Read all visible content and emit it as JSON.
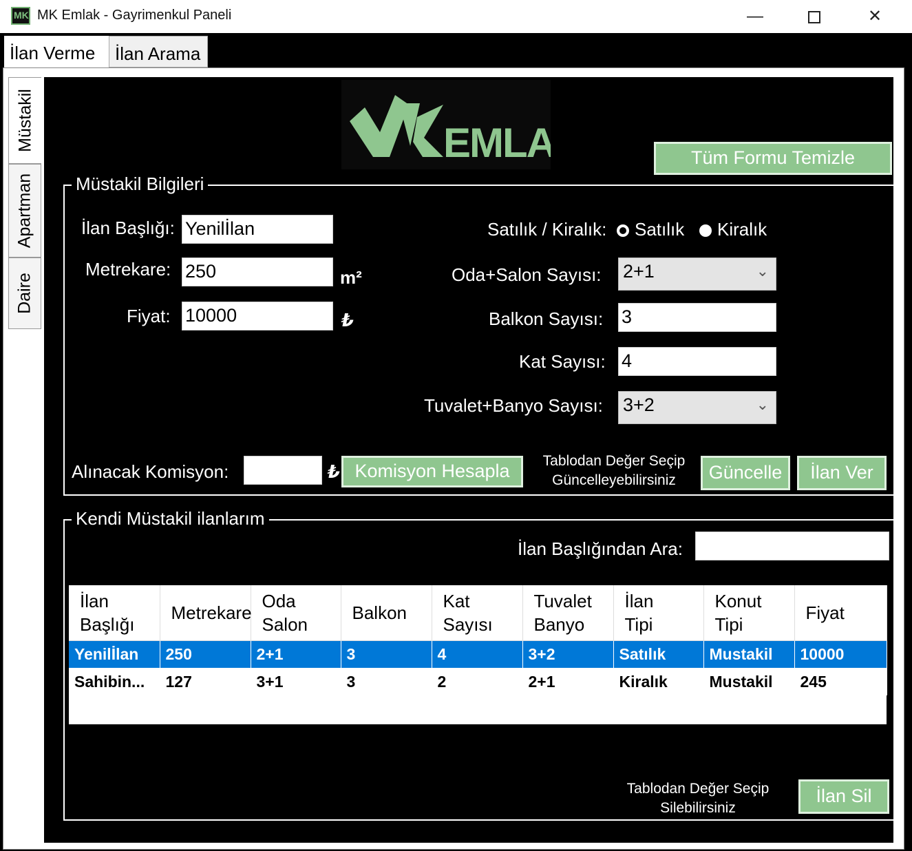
{
  "window": {
    "title": "MK Emlak - Gayrimenkul Paneli",
    "icon_text": "MK",
    "controls": {
      "minimize": "—",
      "close": "✕"
    }
  },
  "tabs": {
    "top": [
      {
        "label": "İlan Verme"
      },
      {
        "label": "İlan Arama"
      }
    ],
    "side": [
      {
        "label": "Müstakil"
      },
      {
        "label": "Apartman"
      },
      {
        "label": "Daire"
      }
    ]
  },
  "logo": {
    "text": "EMLAK",
    "color": "#8fc68f"
  },
  "clear_form_button": "Tüm Formu Temizle",
  "info_group": {
    "title": "Müstakil Bilgileri",
    "ilan_basligi": {
      "label": "İlan Başlığı:",
      "value": "Yenilİlan"
    },
    "metrekare": {
      "label": "Metrekare:",
      "value": "250",
      "unit": "m²"
    },
    "fiyat": {
      "label": "Fiyat:",
      "value": "10000",
      "unit": "₺"
    },
    "satilik_kiralik": {
      "label": "Satılık / Kiralık:",
      "option1": "Satılık",
      "option2": "Kiralık",
      "selected": "Kiralık"
    },
    "oda_salon": {
      "label": "Oda+Salon Sayısı:",
      "value": "2+1"
    },
    "balkon": {
      "label": "Balkon Sayısı:",
      "value": "3"
    },
    "kat": {
      "label": "Kat Sayısı:",
      "value": "4"
    },
    "tuvalet_banyo": {
      "label": "Tuvalet+Banyo Sayısı:",
      "value": "3+2"
    },
    "komisyon": {
      "label": "Alınacak Komisyon:",
      "value": "",
      "unit": "₺"
    },
    "komisyon_button": "Komisyon Hesapla",
    "update_note_1": "Tablodan Değer Seçip",
    "update_note_2": "Güncelleyebilirsiniz",
    "update_button": "Güncelle",
    "post_button": "İlan Ver"
  },
  "mine_group": {
    "title": "Kendi Müstakil ilanlarım",
    "search_label": "İlan Başlığından Ara:",
    "search_value": "",
    "delete_note_1": "Tablodan Değer Seçip",
    "delete_note_2": "Silebilirsiniz",
    "delete_button": "İlan Sil"
  },
  "table": {
    "columns": [
      {
        "line1": "İlan",
        "line2": "Başlığı"
      },
      {
        "line1": "Metrekare",
        "line2": ""
      },
      {
        "line1": "Oda",
        "line2": "Salon"
      },
      {
        "line1": "Balkon",
        "line2": ""
      },
      {
        "line1": "Kat",
        "line2": "Sayısı"
      },
      {
        "line1": "Tuvalet",
        "line2": "Banyo"
      },
      {
        "line1": "İlan",
        "line2": "Tipi"
      },
      {
        "line1": "Konut",
        "line2": "Tipi"
      },
      {
        "line1": "Fiyat",
        "line2": ""
      }
    ],
    "rows": [
      [
        "Yenilİlan",
        "250",
        "2+1",
        "3",
        "4",
        "3+2",
        "Satılık",
        "Mustakil",
        "10000"
      ],
      [
        "Sahibin...",
        "127",
        "3+1",
        "3",
        "2",
        "2+1",
        "Kiralık",
        "Mustakil",
        "245"
      ]
    ],
    "selected_row": 0
  }
}
